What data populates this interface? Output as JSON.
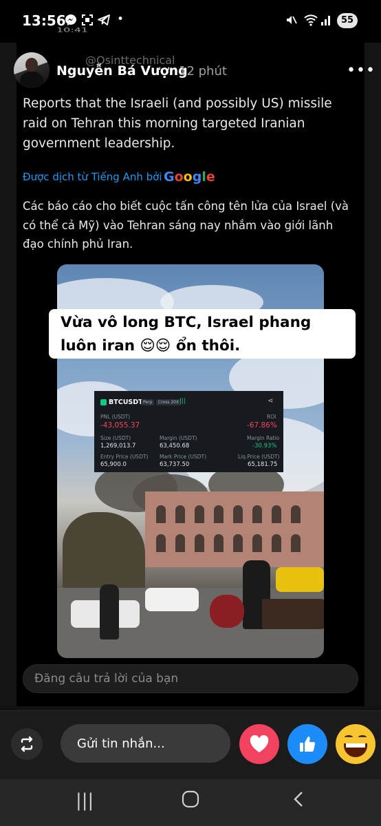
{
  "status_bar": {
    "time": "13:56",
    "left_icons": [
      "messenger-icon",
      "screen-capture-icon",
      "telegram-icon",
      "dot"
    ],
    "right_icons": [
      "vibrate-mute-icon",
      "wifi-icon",
      "signal-icon"
    ],
    "battery": "55"
  },
  "post": {
    "peek_time": "10:41",
    "quoted_handle": "@Osinttechnical",
    "author": "Nguyễn Bá Vượng",
    "time_ago": "12 phút",
    "original_text": "Reports that the Israeli (and possibly US) missile raid on Tehran this morning targeted Iranian government leadership.",
    "translated_by": "Được dịch từ Tiếng Anh bởi",
    "translator_brand": "Google",
    "translated_text": "Các báo cáo cho biết cuộc tấn công tên lửa của Israel (và có thể cả Mỹ) vào Tehran sáng nay nhắm vào giới lãnh đạo chính phủ Iran."
  },
  "image_overlay": {
    "caption": "Vừa vô long BTC, Israel phang luôn iran 😌😌 ổn thôi.",
    "trade": {
      "pair": "BTCUSDT",
      "perp": "Perp",
      "cross": "Cross 20X",
      "pnl_label": "PNL (USDT)",
      "pnl_value": "-43,055.37",
      "roi_label": "ROI",
      "roi_value": "-67.86%",
      "size_label": "Size (USDT)",
      "size_value": "1,269,013.7",
      "margin_label": "Margin (USDT)",
      "margin_value": "63,450.68",
      "margin_ratio_label": "Margin Ratio",
      "margin_ratio_value": "-30.93%",
      "entry_label": "Entry Price (USDT)",
      "entry_value": "65,900.0",
      "mark_label": "Mark Price (USDT)",
      "mark_value": "63,737.50",
      "liq_label": "Liq.Price (USDT)",
      "liq_value": "65,181.75"
    }
  },
  "reply": {
    "placeholder": "Đăng câu trả lời của bạn"
  },
  "message_bar": {
    "placeholder": "Gửi tin nhắn...",
    "reactions": [
      "heart",
      "like",
      "laugh"
    ]
  },
  "nav": {
    "recent": "|||",
    "home": "○",
    "back": "<"
  },
  "colors": {
    "link_blue": "#1d9bf0",
    "loss_red": "#f6465d",
    "heart": "#f2425f",
    "like": "#1d8cf8",
    "laugh": "#f7c531"
  }
}
